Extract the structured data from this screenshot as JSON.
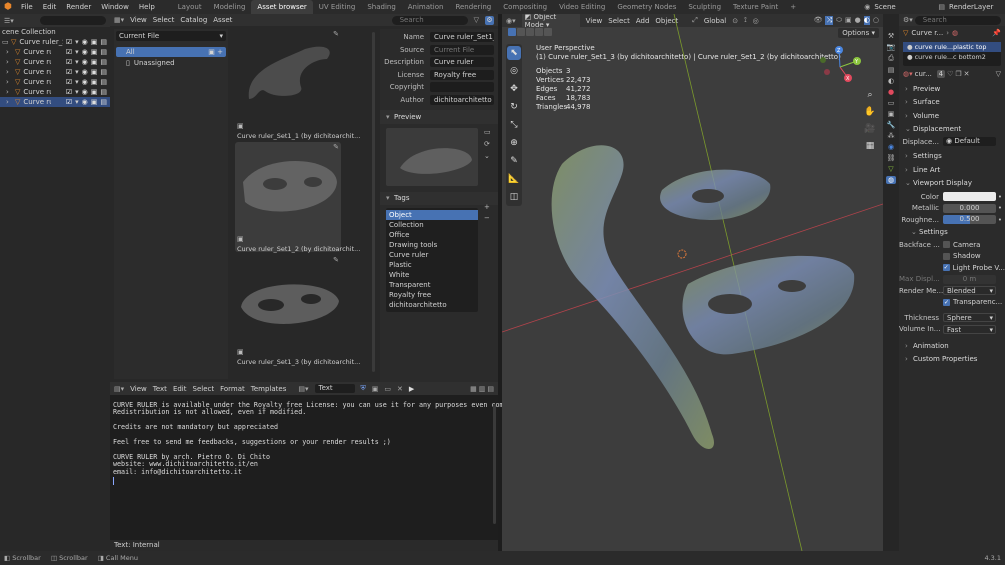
{
  "topbar": {
    "menus": [
      "File",
      "Edit",
      "Render",
      "Window",
      "Help"
    ],
    "workspaces": [
      "Layout",
      "Modeling",
      "Asset browser",
      "UV Editing",
      "Shading",
      "Animation",
      "Rendering",
      "Compositing",
      "Video Editing",
      "Geometry Nodes",
      "Sculpting",
      "Texture Paint"
    ],
    "active_workspace": "Asset browser",
    "scene": "Scene",
    "view_layer": "RenderLayer"
  },
  "outliner": {
    "collection": "cene Collection",
    "rows": [
      {
        "label": "Curve ruler_Set1",
        "selected": false
      },
      {
        "label": "Curve rul",
        "selected": false
      },
      {
        "label": "Curve rul",
        "selected": false
      },
      {
        "label": "Curve rul",
        "selected": false
      },
      {
        "label": "Curve rul",
        "selected": false
      },
      {
        "label": "Curve rul",
        "selected": false
      },
      {
        "label": "Curve rul",
        "selected": true
      }
    ]
  },
  "asset_browser": {
    "menus": [
      "View",
      "Select",
      "Catalog",
      "Asset"
    ],
    "search_placeholder": "Search",
    "library": "Current File",
    "catalogs": [
      "All",
      "Unassigned"
    ],
    "assets": [
      "Curve ruler_Set1_1 (by dichitoarchit...",
      "Curve ruler_Set1_2 (by dichitoarchit...",
      "Curve ruler_Set1_3 (by dichitoarchit..."
    ],
    "meta": {
      "name_label": "Name",
      "name": "Curve ruler_Set1_1 (...",
      "source_label": "Source",
      "source": "Current File",
      "description_label": "Description",
      "description": "Curve ruler",
      "license_label": "License",
      "license": "Royalty free",
      "copyright_label": "Copyright",
      "copyright": "",
      "author_label": "Author",
      "author": "dichitoarchitetto"
    },
    "preview_title": "Preview",
    "tags_title": "Tags",
    "tags": [
      "Object",
      "Collection",
      "Office",
      "Drawing tools",
      "Curve ruler",
      "Plastic",
      "White",
      "Transparent",
      "Royalty free",
      "dichitoarchitetto"
    ]
  },
  "text_editor": {
    "menus": [
      "View",
      "Text",
      "Edit",
      "Select",
      "Format",
      "Templates"
    ],
    "datablock": "Text",
    "lines": [
      "CURVE RULER is available under the Royalty free License: you can use it for any purposes even commercial.",
      "Redistribution is not allowed, even if modified.",
      "",
      "Credits are not mandatory but appreciated",
      "",
      "Feel free to send me feedbacks, suggestions or your render results ;)",
      "",
      "CURVE RULER by arch. Pietro O. Di Chito",
      "website: www.dichitoarchitetto.it/en",
      "email: info@dichitoarchitetto.it"
    ],
    "footer": "Text: Internal"
  },
  "viewport": {
    "mode": "Object Mode",
    "menus": [
      "View",
      "Select",
      "Add",
      "Object"
    ],
    "orientation": "Global",
    "options_label": "Options",
    "perspective": "User Perspective",
    "context": "(1) Curve ruler_Set1_3 (by dichitoarchitetto) | Curve ruler_Set1_2 (by dichitoarchitetto)",
    "stats": [
      {
        "label": "Objects",
        "value": "3"
      },
      {
        "label": "Vertices",
        "value": "22,473"
      },
      {
        "label": "Edges",
        "value": "41,272"
      },
      {
        "label": "Faces",
        "value": "18,783"
      },
      {
        "label": "Triangles",
        "value": "44,978"
      }
    ],
    "gizmo": {
      "x": "X",
      "y": "Y",
      "z": "Z"
    }
  },
  "properties": {
    "search_placeholder": "Search",
    "object": "Curve r...",
    "material_slots": [
      "curve rule...plastic top",
      "curve rule...c bottom2"
    ],
    "material_name": "cur...",
    "material_users": "4",
    "sections": {
      "preview": "Preview",
      "surface": "Surface",
      "volume": "Volume",
      "displacement": "Displacement",
      "settings": "Settings",
      "line_art": "Line Art",
      "viewport_display": "Viewport Display",
      "settings_sub": "Settings",
      "animation": "Animation",
      "custom_properties": "Custom Properties"
    },
    "fields": {
      "displacement_label": "Displace...",
      "displacement": "Default",
      "color_label": "Color",
      "metallic_label": "Metallic",
      "metallic": "0.000",
      "roughness_label": "Roughne...",
      "roughness": "0.500",
      "backface_label": "Backface ...",
      "camera": "Camera",
      "shadow": "Shadow",
      "light_probe": "Light Probe V...",
      "max_disp_label": "Max Displ...",
      "max_disp": "0 m",
      "render_method_label": "Render Me...",
      "render_method": "Blended",
      "transparency": "Transparenc...",
      "thickness_label": "Thickness",
      "thickness": "Sphere",
      "volume_int_label": "Volume In...",
      "volume_int": "Fast"
    },
    "roughness_fraction": 0.5
  },
  "statusbar": {
    "items": [
      "Scrollbar",
      "Scrollbar",
      "Call Menu"
    ],
    "version": "4.3.1"
  },
  "colors": {
    "accent": "#4772b3",
    "selected": "#334d80",
    "tag_active": "#4772b3",
    "header": "#303030",
    "panel": "#282828",
    "viewport": "#3d3d3d"
  }
}
